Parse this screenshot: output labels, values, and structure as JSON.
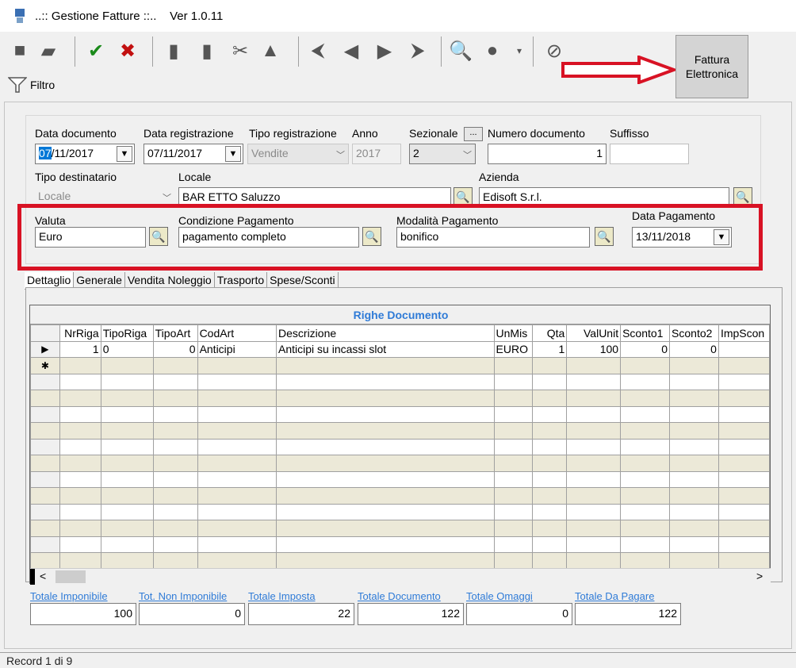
{
  "window": {
    "title": "..:: Gestione Fatture ::..    Ver 1.0.11"
  },
  "toolbar": {
    "fattura_button": "Fattura\nElettronica",
    "filter_label": "Filtro"
  },
  "header": {
    "data_documento": {
      "label": "Data documento",
      "value_sel": "07",
      "value_rest": "/11/2017"
    },
    "data_registrazione": {
      "label": "Data registrazione",
      "value": "07/11/2017"
    },
    "tipo_registrazione": {
      "label": "Tipo registrazione",
      "value": "Vendite"
    },
    "anno": {
      "label": "Anno",
      "value": "2017"
    },
    "sezionale": {
      "label": "Sezionale",
      "value": "2",
      "button": "..."
    },
    "numero_documento": {
      "label": "Numero documento",
      "value": "1"
    },
    "suffisso": {
      "label": "Suffisso",
      "value": ""
    },
    "tipo_destinatario": {
      "label": "Tipo destinatario",
      "value": "Locale"
    },
    "locale": {
      "label": "Locale",
      "value": "BAR ETTO Saluzzo"
    },
    "azienda": {
      "label": "Azienda",
      "value": "Edisoft S.r.l."
    },
    "valuta": {
      "label": "Valuta",
      "value": "Euro"
    },
    "condizione_pagamento": {
      "label": "Condizione Pagamento",
      "value": "pagamento completo"
    },
    "modalita_pagamento": {
      "label": "Modalità Pagamento",
      "value": "bonifico"
    },
    "data_pagamento": {
      "label": "Data Pagamento",
      "value": "13/11/2018"
    }
  },
  "tabs": [
    "Dettaglio",
    "Generale",
    "Vendita Noleggio",
    "Trasporto",
    "Spese/Sconti"
  ],
  "grid": {
    "title": "Righe Documento",
    "columns": [
      "NrRiga",
      "TipoRiga",
      "TipoArt",
      "CodArt",
      "Descrizione",
      "UnMis",
      "Qta",
      "ValUnit",
      "Sconto1",
      "Sconto2",
      "ImpScon"
    ],
    "row": [
      "1",
      "0",
      "0",
      "Anticipi",
      "Anticipi su incassi slot",
      "EURO",
      "1",
      "100",
      "0",
      "0",
      ""
    ]
  },
  "totals": [
    {
      "label": "Totale Imponibile",
      "value": "100"
    },
    {
      "label": "Tot. Non Imponibile",
      "value": "0"
    },
    {
      "label": "Totale Imposta",
      "value": "22"
    },
    {
      "label": "Totale Documento",
      "value": "122"
    },
    {
      "label": "Totale Omaggi",
      "value": "0"
    },
    {
      "label": "Totale Da Pagare",
      "value": "122"
    }
  ],
  "status": "Record 1 di 9",
  "colors": {
    "highlight_red": "#d81224",
    "accent_blue": "#2f7bd7",
    "selection_blue": "#0078d7",
    "alt_row": "#ece9d8"
  },
  "icons": [
    "app-icon",
    "save-copy-icon",
    "folder-icon",
    "confirm-save-icon",
    "delete-save-icon",
    "doc-icon",
    "doc2-icon",
    "cut-icon",
    "paste-icon",
    "first-record-icon",
    "prev-record-icon",
    "next-record-icon",
    "last-record-icon",
    "search-icon",
    "options-icon",
    "cancel-icon",
    "funnel-icon",
    "lookup-icon",
    "arrow-icon"
  ]
}
